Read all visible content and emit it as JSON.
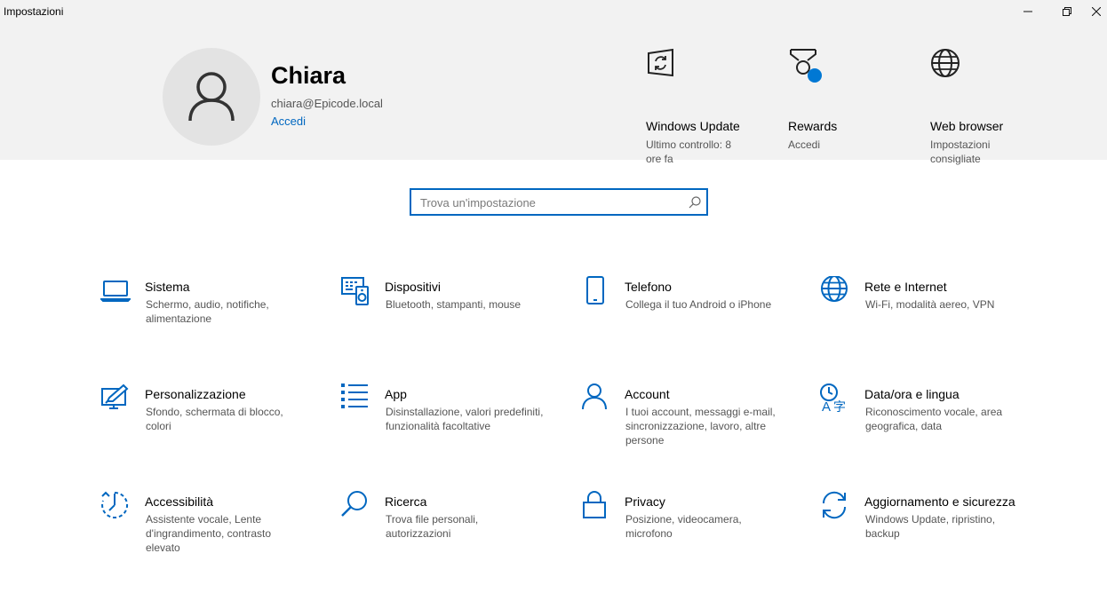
{
  "window": {
    "title": "Impostazioni",
    "controls": [
      "minimize",
      "maximize",
      "close"
    ]
  },
  "profile": {
    "name": "Chiara",
    "email": "chiara@Epicode.local",
    "signin_link": "Accedi"
  },
  "quick_links": [
    {
      "icon": "windows-update-icon",
      "title": "Windows Update",
      "subtitle": "Ultimo controllo: 8 ore fa"
    },
    {
      "icon": "rewards-icon",
      "title": "Rewards",
      "subtitle": "Accedi"
    },
    {
      "icon": "globe-icon",
      "title": "Web browser",
      "subtitle": "Impostazioni consigliate"
    }
  ],
  "search": {
    "placeholder": "Trova un'impostazione"
  },
  "categories": [
    {
      "icon": "laptop-icon",
      "title": "Sistema",
      "description": "Schermo, audio, notifiche, alimentazione"
    },
    {
      "icon": "devices-icon",
      "title": "Dispositivi",
      "description": "Bluetooth, stampanti, mouse"
    },
    {
      "icon": "phone-icon",
      "title": "Telefono",
      "description": "Collega il tuo Android o iPhone"
    },
    {
      "icon": "globe-icon",
      "title": "Rete e Internet",
      "description": "Wi-Fi, modalità aereo, VPN"
    },
    {
      "icon": "personalization-icon",
      "title": "Personalizzazione",
      "description": "Sfondo, schermata di blocco, colori"
    },
    {
      "icon": "apps-list-icon",
      "title": "App",
      "description": "Disinstallazione, valori predefiniti, funzionalità facoltative"
    },
    {
      "icon": "person-icon",
      "title": "Account",
      "description": "I tuoi account, messaggi e-mail, sincronizzazione, lavoro, altre persone"
    },
    {
      "icon": "time-language-icon",
      "title": "Data/ora e lingua",
      "description": "Riconoscimento vocale, area geografica, data"
    },
    {
      "icon": "accessibility-icon",
      "title": "Accessibilità",
      "description": "Assistente vocale, Lente d'ingrandimento, contrasto elevato"
    },
    {
      "icon": "search-icon",
      "title": "Ricerca",
      "description": "Trova file personali, autorizzazioni"
    },
    {
      "icon": "lock-icon",
      "title": "Privacy",
      "description": "Posizione, videocamera, microfono"
    },
    {
      "icon": "sync-icon",
      "title": "Aggiornamento e sicurezza",
      "description": "Windows Update, ripristino, backup"
    }
  ],
  "colors": {
    "accent": "#0067c0",
    "header_bg": "#f2f2f2",
    "secondary_text": "#555555",
    "rewards_badge": "#0078d4"
  }
}
